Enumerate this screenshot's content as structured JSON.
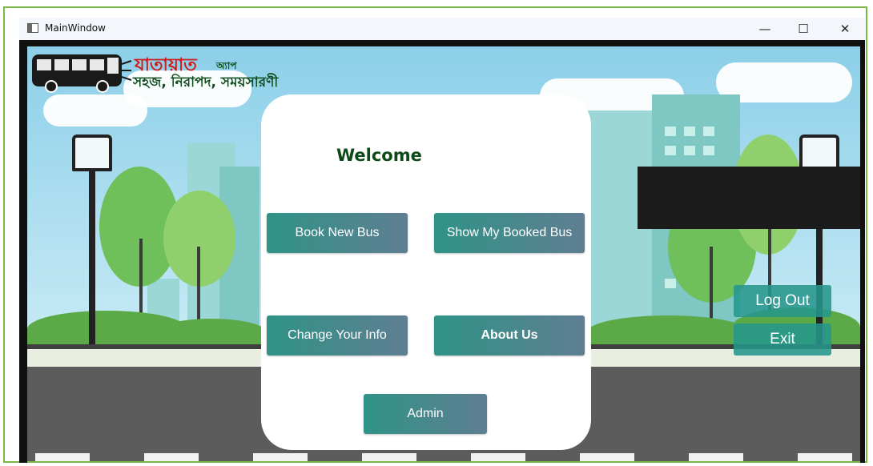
{
  "window": {
    "title": "MainWindow",
    "controls": {
      "minimize": "—",
      "maximize": "☐",
      "close": "✕"
    }
  },
  "logo": {
    "main_text": "যাতায়াত",
    "sub_text": "অ্যাপ",
    "tagline": "সহজ, নিরাপদ, সময়সারণী"
  },
  "card": {
    "welcome": "Welcome",
    "buttons": {
      "book_new_bus": "Book New Bus",
      "show_my_booked_bus": "Show My Booked Bus",
      "change_your_info": "Change Your Info",
      "about_us": "About Us",
      "admin": "Admin"
    }
  },
  "side": {
    "log_out": "Log Out",
    "exit": "Exit"
  },
  "colors": {
    "window_border": "#7ab648",
    "welcome_text": "#0d4a17",
    "button_gradient_start": "#2f9387",
    "button_gradient_end": "#5f7e92",
    "logo_red": "#d11a1a",
    "logo_green": "#0f4d1c"
  }
}
